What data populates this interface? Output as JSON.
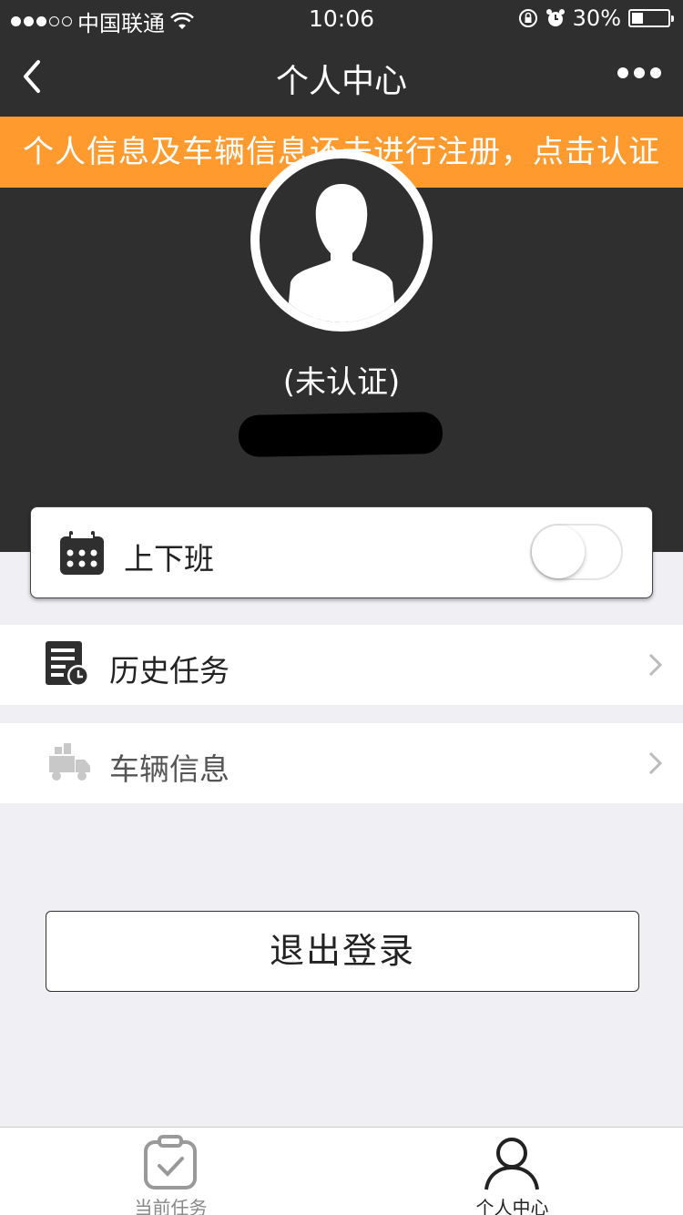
{
  "status_bar": {
    "carrier": "中国联通",
    "time": "10:06",
    "battery": "30%"
  },
  "nav": {
    "title": "个人中心"
  },
  "notice": {
    "text": "个人信息及车辆信息还未进行注册，点击认证"
  },
  "profile": {
    "status": "(未认证)"
  },
  "shift": {
    "label": "上下班",
    "toggle_on": false
  },
  "menu": {
    "history_label": "历史任务",
    "vehicle_label": "车辆信息"
  },
  "logout": {
    "label": "退出登录"
  },
  "tabs": [
    {
      "label": "当前任务",
      "active": false
    },
    {
      "label": "个人中心",
      "active": true
    }
  ],
  "colors": {
    "dark": "#2f2f2f",
    "notice": "#ff9a2e",
    "background": "#efeff4"
  }
}
